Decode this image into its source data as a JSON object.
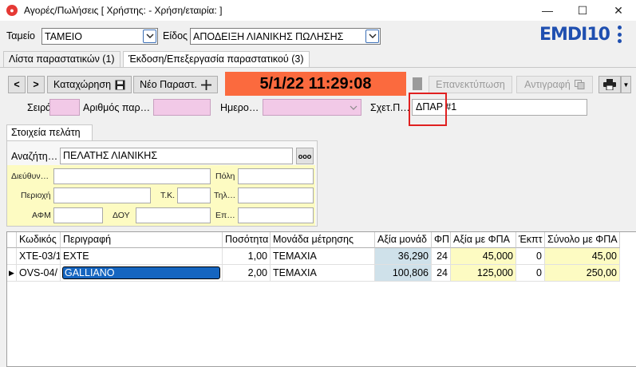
{
  "window": {
    "title": "Αγορές/Πωλήσεις  [ Χρήστης:                - Χρήση/εταιρία:                ]",
    "minimize": "—",
    "maximize": "☐",
    "close": "✕"
  },
  "header": {
    "tameio_label": "Ταμείο",
    "tameio_value": "ΤΑΜΕΙΟ",
    "eidos_label": "Είδος",
    "eidos_value": "ΑΠΟΔΕΙΞΗ ΛΙΑΝΙΚΗΣ ΠΩΛΗΣΗΣ",
    "logo_text": "EMDI10"
  },
  "tabs": [
    {
      "label": "Λίστα παραστατικών (1)",
      "active": false
    },
    {
      "label": "Έκδοση/Επεξεργασία παραστατικού (3)",
      "active": true
    }
  ],
  "toolbar": {
    "prev": "<",
    "next": ">",
    "save_label": "Καταχώρηση",
    "new_label": "Νέο Παραστ.",
    "datetime": "5/1/22 11:29:08",
    "reprint_label": "Επανεκτύπωση",
    "copy_label": "Αντιγραφή"
  },
  "doc": {
    "seira_label": "Σειρά",
    "arithmos_label": "Αριθμός παρ…",
    "hmero_label": "Ημερο…",
    "sxet_label": "Σχετ.Π…",
    "sxet_value": "ΔΠΑΡ #1"
  },
  "customer": {
    "group_label": "Στοιχεία πελάτη",
    "search_label": "Αναζήτη…",
    "search_value": "ΠΕΛΑΤΗΣ ΛΙΑΝΙΚΗΣ",
    "dots": "ooo",
    "address_label": "Διεύθυν…",
    "city_label": "Πόλη",
    "area_label": "Περιοχή",
    "tk_label": "Τ.Κ.",
    "phone_label": "Τηλ…",
    "afm_label": "ΑΦΜ",
    "doy_label": "ΔΟΥ",
    "ep_label": "Επ…"
  },
  "grid": {
    "columns": [
      "Κωδικός",
      "Περιγραφή",
      "Ποσότητα",
      "Μονάδα μέτρησης",
      "Αξία μονάδ",
      "ΦΠ",
      "Αξία με ΦΠΑ",
      "Έκπτ",
      "Σύνολο με ΦΠΑ"
    ],
    "rows": [
      {
        "marker": "",
        "code": "XTE-03/1",
        "desc": "EXTE",
        "qty": "1,00",
        "unit": "ΤΕΜΑΧΙΑ",
        "price": "36,290",
        "vat": "24",
        "price_vat": "45,000",
        "disc": "0",
        "total": "45,00"
      },
      {
        "marker": "▶",
        "code": "OVS-04/",
        "desc": "GALLIANO",
        "qty": "2,00",
        "unit": "ΤΕΜΑΧΙΑ",
        "price": "100,806",
        "vat": "24",
        "price_vat": "125,000",
        "disc": "0",
        "total": "250,00"
      }
    ]
  },
  "colors": {
    "datetime_bg": "#fb6a3e",
    "highlight": "#e02020",
    "logo": "#1f4fb0",
    "pink_field": "#f2c9e7",
    "yellow": "#fdfbc2",
    "blue_cell": "#cfe1ea"
  }
}
